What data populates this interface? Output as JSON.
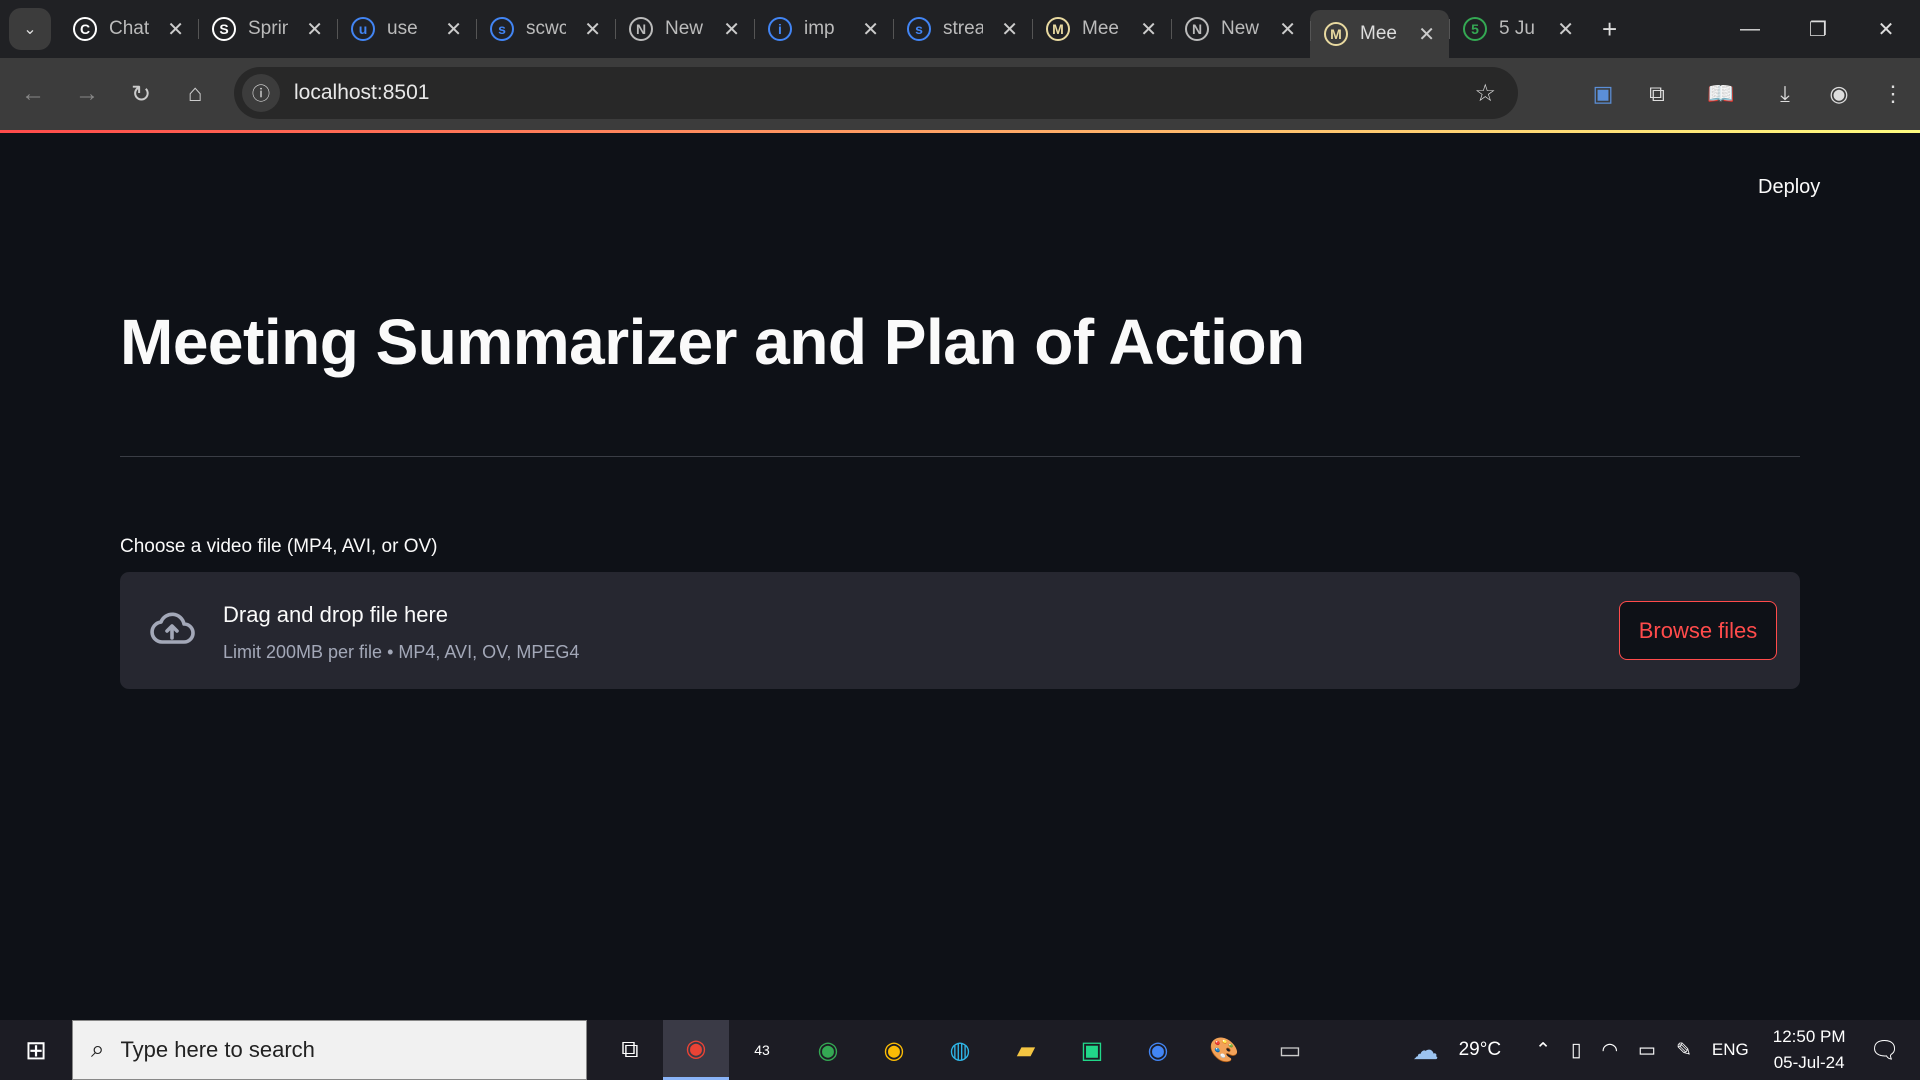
{
  "browser": {
    "tabs": [
      {
        "title": "ChatGPT",
        "icon": "chatgpt-icon",
        "color": "#ffffff"
      },
      {
        "title": "Spring",
        "icon": "github-icon",
        "color": "#ffffff"
      },
      {
        "title": "use",
        "icon": "google-icon",
        "color": "#4285f4"
      },
      {
        "title": "scwc",
        "icon": "google-icon",
        "color": "#4285f4"
      },
      {
        "title": "New",
        "icon": "chrome-icon",
        "color": "#bbbbbb"
      },
      {
        "title": "imp",
        "icon": "google-icon",
        "color": "#4285f4"
      },
      {
        "title": "strea",
        "icon": "google-icon",
        "color": "#4285f4"
      },
      {
        "title": "Mee",
        "icon": "streamlit-page-icon",
        "color": "#e8d9a0"
      },
      {
        "title": "New",
        "icon": "chrome-icon",
        "color": "#bbbbbb"
      },
      {
        "title": "Mee",
        "icon": "streamlit-page-icon",
        "color": "#e8d9a0",
        "active": true
      },
      {
        "title": "5 Ju",
        "icon": "drive-icon",
        "color": "#34a853"
      }
    ],
    "url": "localhost:8501"
  },
  "app": {
    "deploy_label": "Deploy",
    "title": "Meeting Summarizer and Plan of Action",
    "uploader": {
      "label": "Choose a video file (MP4, AVI, or OV)",
      "drop_title": "Drag and drop file here",
      "drop_sub": "Limit 200MB per file • MP4, AVI, OV, MPEG4",
      "browse_label": "Browse files"
    },
    "accent": "#ff4b4b"
  },
  "taskbar": {
    "search_placeholder": "Type here to search",
    "weather": "29°C",
    "lang": "ENG",
    "time": "12:50 PM",
    "date": "05-Jul-24",
    "badge": "43"
  }
}
